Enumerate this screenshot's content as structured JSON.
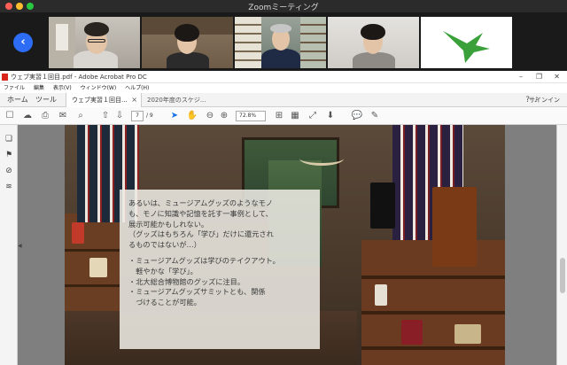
{
  "zoom": {
    "title": "Zoomミーティング",
    "back_button_glyph": "‹",
    "participants": [
      {
        "id": "p1"
      },
      {
        "id": "p2"
      },
      {
        "id": "p3"
      },
      {
        "id": "p4"
      },
      {
        "id": "p5",
        "type": "logo-bird",
        "color": "#3aa13a"
      }
    ]
  },
  "acrobat": {
    "window_title": "ウェブ実習１回目.pdf - Adobe Acrobat Pro DC",
    "menu": [
      "ファイル",
      "編集",
      "表示(V)",
      "ウィンドウ(W)",
      "ヘルプ(H)"
    ],
    "tabs": {
      "home": "ホーム",
      "tools": "ツール",
      "doc1": "ウェブ実習１回目...",
      "doc2": "2020年度のスケジ...",
      "signin": "サインイン"
    },
    "toolbar": {
      "current_page": "7",
      "total_pages": "/ 9",
      "zoom": "72.8%"
    },
    "icons": {
      "save": "save-icon",
      "upload": "upload-icon",
      "print": "print-icon",
      "mail": "mail-icon",
      "search": "search-icon",
      "page_up": "page-up-icon",
      "page_down": "page-down-icon",
      "select": "select-arrow-icon",
      "hand": "hand-icon",
      "zoom_out": "zoom-out-icon",
      "zoom_in": "zoom-in-icon",
      "comment": "comment-icon",
      "pen": "pen-icon"
    }
  },
  "slide": {
    "line1": "あるいは、ミュージアムグッズのようなモノ",
    "line2": "も、モノに知識や記憶を託す一事例として、",
    "line3": "展示可能かもしれない。",
    "line4": "（グッズはもちろん「学び」だけに還元され",
    "line5": "るものではないが…）",
    "bullet1a": "・ミュージアムグッズは学びのテイクアウト。",
    "bullet1b": "　軽やかな「学び」。",
    "bullet2": "・北大総合博物館のグッズに注目。",
    "bullet3a": "・ミュージアムグッズサミットとも、関係",
    "bullet3b": "　づけることが可能。"
  }
}
